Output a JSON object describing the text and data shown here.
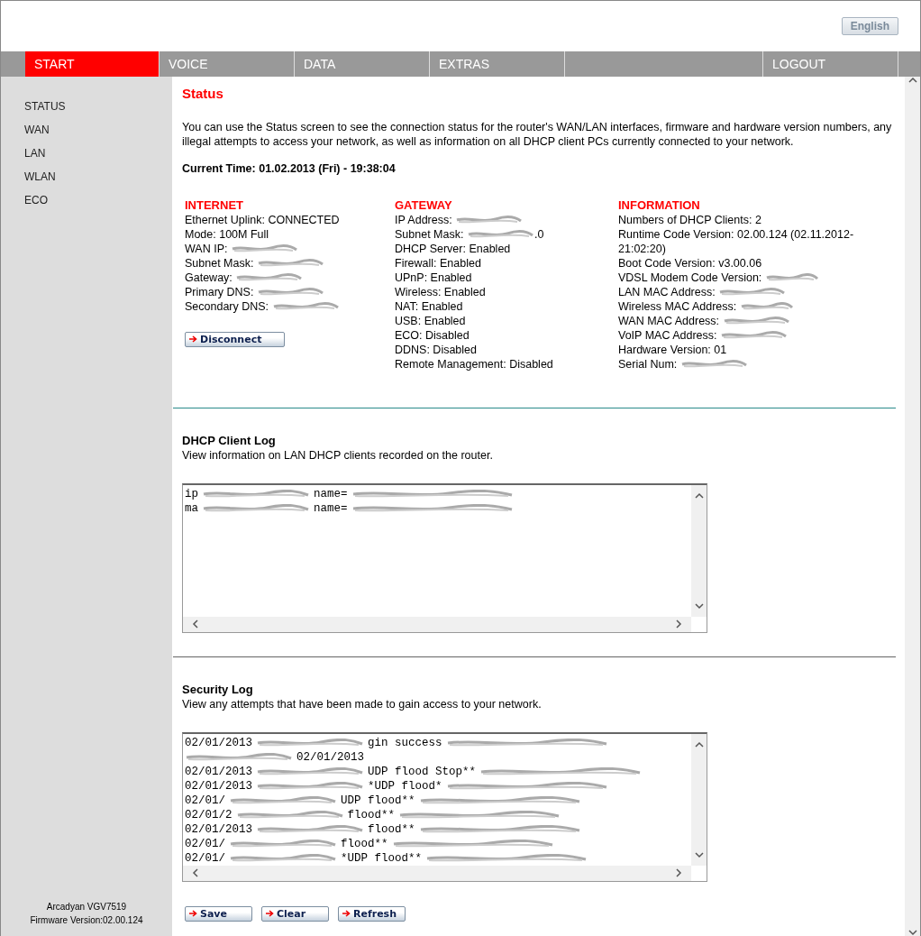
{
  "header": {
    "language_button": "English"
  },
  "nav_tabs": [
    {
      "label": "START",
      "selected": true
    },
    {
      "label": "VOICE",
      "selected": false
    },
    {
      "label": "DATA",
      "selected": false
    },
    {
      "label": "EXTRAS",
      "selected": false
    },
    {
      "selected": false
    },
    {
      "label": "LOGOUT",
      "selected": false
    }
  ],
  "sidebar": {
    "items": [
      {
        "label": "STATUS"
      },
      {
        "label": "WAN"
      },
      {
        "label": "LAN"
      },
      {
        "label": "WLAN"
      },
      {
        "label": "ECO"
      }
    ],
    "footer": [
      "Arcadyan VGV7519",
      "Firmware Version:02.00.124"
    ]
  },
  "page": {
    "title": "Status",
    "intro": "You can use the Status screen to see the connection status for the router's WAN/LAN interfaces, firmware and hardware version numbers, any illegal attempts to access your network, as well as information on all DHCP client PCs currently connected to your network.",
    "current_time": "Current Time: 01.02.2013 (Fri) - 19:38:04"
  },
  "status_columns": [
    {
      "heading": "INTERNET",
      "rows": [
        {
          "label": "Ethernet Uplink:",
          "value": "CONNECTED",
          "redacted": false
        },
        {
          "label": "Mode:",
          "value": "100M Full",
          "redacted": false
        },
        {
          "label": "WAN IP:",
          "redacted": true
        },
        {
          "label": "Subnet Mask:",
          "redacted": true
        },
        {
          "label": "Gateway:",
          "redacted": true
        },
        {
          "label": "Primary DNS:",
          "redacted": true
        },
        {
          "label": "Secondary DNS:",
          "redacted": true
        }
      ],
      "button": "Disconnect"
    },
    {
      "heading": "GATEWAY",
      "rows": [
        {
          "label": "IP Address:",
          "redacted": true
        },
        {
          "label": "Subnet Mask:",
          "value": ".0",
          "redacted": true
        },
        {
          "label": "DHCP Server:",
          "value": "Enabled",
          "redacted": false
        },
        {
          "label": "Firewall:",
          "value": "Enabled",
          "redacted": false
        },
        {
          "label": "UPnP:",
          "value": "Enabled",
          "redacted": false
        },
        {
          "label": "Wireless:",
          "value": "Enabled",
          "redacted": false
        },
        {
          "label": "NAT:",
          "value": "Enabled",
          "redacted": false
        },
        {
          "label": "USB:",
          "value": "Enabled",
          "redacted": false
        },
        {
          "label": "ECO:",
          "value": "Disabled",
          "redacted": false
        },
        {
          "label": "DDNS:",
          "value": "Disabled",
          "redacted": false
        },
        {
          "label": "Remote Management:",
          "value": "Disabled",
          "redacted": false
        }
      ]
    },
    {
      "heading": "INFORMATION",
      "rows": [
        {
          "label": "Numbers of DHCP Clients:",
          "value": "2",
          "redacted": false
        },
        {
          "label": "Runtime Code Version:",
          "value": "02.00.124 (02.11.2012-21:02:20)",
          "redacted": false
        },
        {
          "label": "Boot Code Version:",
          "value": "v3.00.06",
          "redacted": false
        },
        {
          "label": "VDSL Modem Code Version:",
          "redacted": true
        },
        {
          "label": "LAN MAC Address:",
          "redacted": true
        },
        {
          "label": "Wireless MAC Address:",
          "redacted": true
        },
        {
          "label": "WAN MAC Address:",
          "redacted": true
        },
        {
          "label": "VoIP MAC Address:",
          "redacted": true
        },
        {
          "label": "Hardware Version:",
          "value": "01",
          "redacted": false
        },
        {
          "label": "Serial Num:",
          "redacted": true
        }
      ]
    }
  ],
  "dhcp_log": {
    "title": "DHCP Client Log",
    "description": "View information on LAN DHCP clients recorded on the router.",
    "lines": [
      [
        "ip",
        "name="
      ],
      [
        "ma",
        "name="
      ]
    ]
  },
  "security_log": {
    "title": "Security Log",
    "description": "View any attempts that have been made to gain access to your network.",
    "lines": [
      [
        "02/01/2013",
        "gin success"
      ],
      [
        "02/01/2013"
      ],
      [
        "02/01/2013",
        "UDP flood Stop**"
      ],
      [
        "02/01/2013",
        "*UDP flood*"
      ],
      [
        "02/01/",
        "UDP flood**"
      ],
      [
        "02/01/2",
        "flood**"
      ],
      [
        "02/01/2013",
        "flood**"
      ],
      [
        "02/01/",
        "flood**"
      ],
      [
        "02/01/",
        "*UDP flood**"
      ]
    ],
    "buttons": [
      "Save",
      "Clear",
      "Refresh"
    ]
  }
}
